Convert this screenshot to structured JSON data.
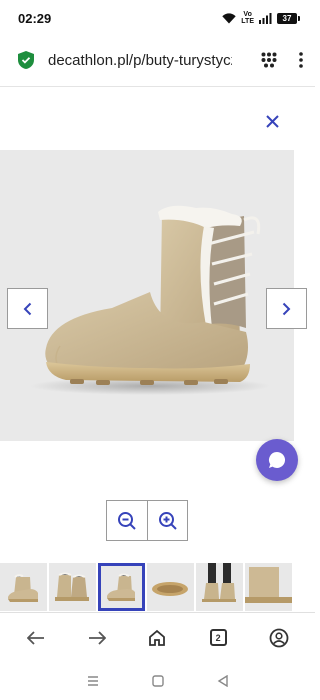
{
  "status_bar": {
    "time": "02:29",
    "network": "Vo LTE",
    "battery": "37"
  },
  "address_bar": {
    "url": "decathlon.pl/p/buty-turystyczne"
  },
  "product_viewer": {
    "current_image_index": 3,
    "thumbnail_count": 6
  },
  "bottom_nav": {
    "tab_count": "2"
  },
  "colors": {
    "accent": "#3643ba",
    "chat": "#6a5ccf",
    "secure": "#1e8e3e",
    "close": "#3643ba"
  }
}
